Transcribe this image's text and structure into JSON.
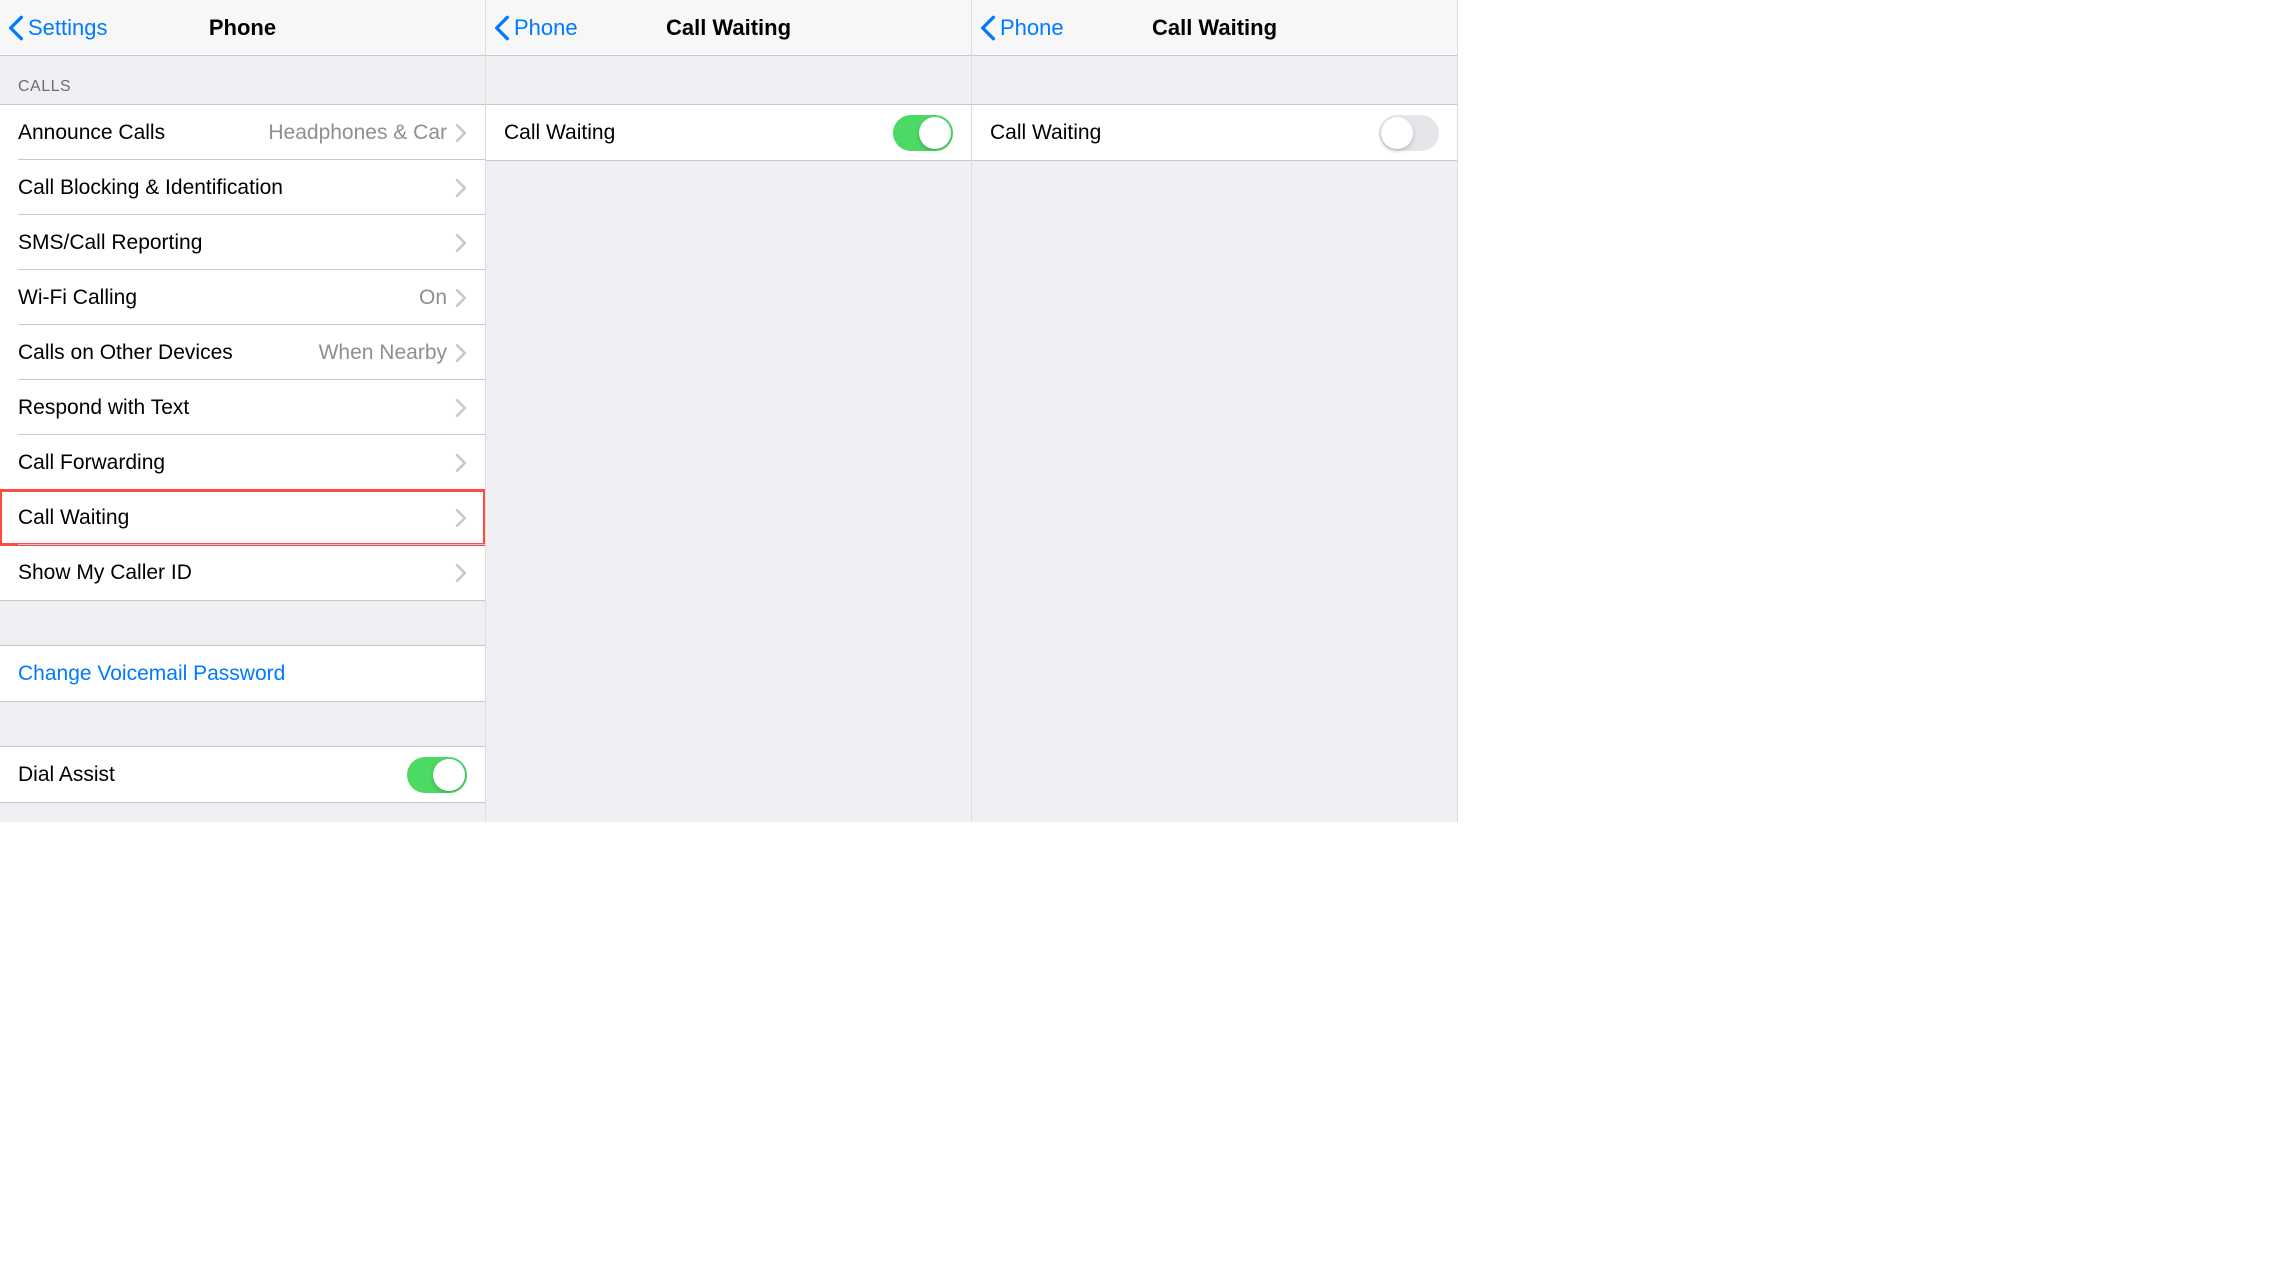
{
  "screens": [
    {
      "nav": {
        "back": "Settings",
        "title": "Phone"
      },
      "section_header": "CALLS",
      "rows": [
        {
          "label": "Announce Calls",
          "detail": "Headphones & Car"
        },
        {
          "label": "Call Blocking & Identification"
        },
        {
          "label": "SMS/Call Reporting"
        },
        {
          "label": "Wi-Fi Calling",
          "detail": "On"
        },
        {
          "label": "Calls on Other Devices",
          "detail": "When Nearby"
        },
        {
          "label": "Respond with Text"
        },
        {
          "label": "Call Forwarding"
        },
        {
          "label": "Call Waiting",
          "highlighted": true
        },
        {
          "label": "Show My Caller ID"
        }
      ],
      "voicemail_row": {
        "label": "Change Voicemail Password"
      },
      "dial_assist_row": {
        "label": "Dial Assist",
        "toggle": "on"
      }
    },
    {
      "nav": {
        "back": "Phone",
        "title": "Call Waiting"
      },
      "toggle_row": {
        "label": "Call Waiting",
        "toggle": "on"
      }
    },
    {
      "nav": {
        "back": "Phone",
        "title": "Call Waiting"
      },
      "toggle_row": {
        "label": "Call Waiting",
        "toggle": "off"
      }
    }
  ]
}
